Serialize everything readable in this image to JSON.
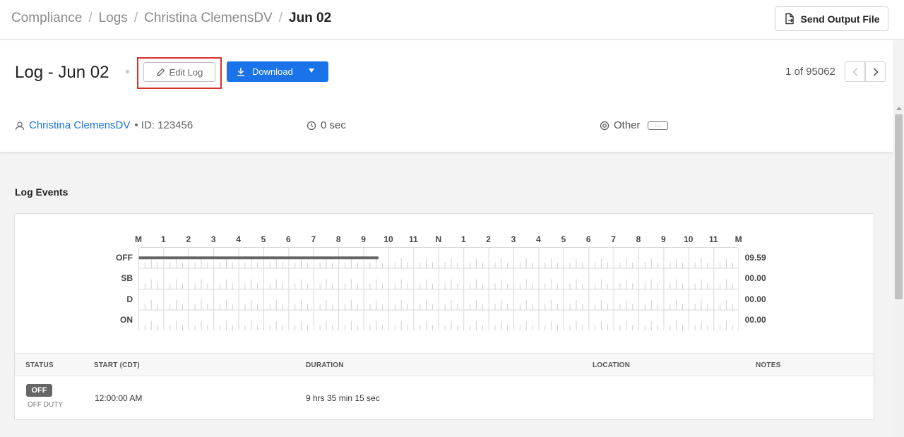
{
  "breadcrumb": {
    "items": [
      "Compliance",
      "Logs",
      "Christina ClemensDV"
    ],
    "separator": "/",
    "current": "Jun 02"
  },
  "topbar": {
    "send_output_label": "Send Output File"
  },
  "log": {
    "title": "Log - Jun 02",
    "edit_label": "Edit Log",
    "download_label": "Download",
    "pager": "1 of 95062"
  },
  "meta": {
    "driver_name": "Christina ClemensDV",
    "driver_id": "• ID: 123456",
    "duration": "0 sec",
    "other_label": "Other",
    "ellipsis": "···"
  },
  "events": {
    "title": "Log Events",
    "hours": [
      "M",
      "1",
      "2",
      "3",
      "4",
      "5",
      "6",
      "7",
      "8",
      "9",
      "10",
      "11",
      "N",
      "1",
      "2",
      "3",
      "4",
      "5",
      "6",
      "7",
      "8",
      "9",
      "10",
      "11",
      "M"
    ],
    "rows": [
      {
        "label": "OFF",
        "total": "09.59"
      },
      {
        "label": "SB",
        "total": "00.00"
      },
      {
        "label": "D",
        "total": "00.00"
      },
      {
        "label": "ON",
        "total": "00.00"
      }
    ],
    "segments": [
      {
        "row": 0,
        "start_hour": 0,
        "end_hour": 9.5875
      }
    ],
    "columns": {
      "status": "STATUS",
      "start": "START (CDT)",
      "duration": "DURATION",
      "location": "LOCATION",
      "notes": "NOTES"
    },
    "entries": [
      {
        "status": "OFF",
        "status_full": "OFF DUTY",
        "start": "12:00:00 AM",
        "duration": "9 hrs 35 min 15 sec",
        "location": "",
        "notes": ""
      }
    ]
  },
  "colors": {
    "accent": "#1a73e8",
    "highlight": "#d9302c",
    "segment": "#666666"
  }
}
